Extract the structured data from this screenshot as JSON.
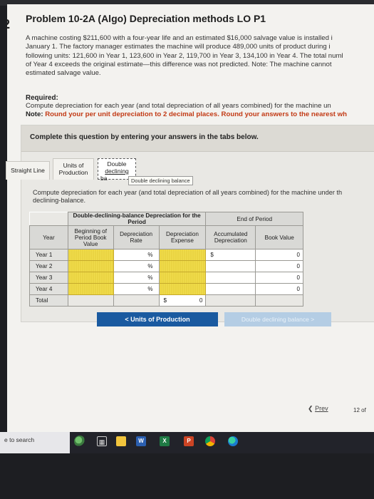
{
  "problem": {
    "marker": "2",
    "title": "Problem 10-2A (Algo) Depreciation methods LO P1",
    "paragraph": [
      "A machine costing $211,600 with a four-year life and an estimated $16,000 salvage value is installed i",
      "January 1. The factory manager estimates the machine will produce 489,000 units of product during i",
      "following units: 121,600 in Year 1, 123,600 in Year 2, 119,700 in Year 3, 134,100 in Year 4. The total numl",
      "of Year 4 exceeds the original estimate—this difference was not predicted. Note: The machine cannot",
      "estimated salvage value."
    ],
    "required_label": "Required:",
    "required_text": "Compute depreciation for each year (and total depreciation of all years combined) for the machine un",
    "note_label": "Note:",
    "note_text": "Round your per unit depreciation to 2 decimal places. Round your answers to the nearest wh"
  },
  "panel": {
    "title": "Complete this question by entering your answers in the tabs below.",
    "tabs": [
      {
        "label": "Straight Line"
      },
      {
        "label_l1": "Units of",
        "label_l2": "Production"
      },
      {
        "label_l1": "Double",
        "label_l2": "declining",
        "label_l3": "ba"
      }
    ],
    "tooltip": "Double declining balance",
    "instruction_l1": "Compute depreciation for each year (and total depreciation of all years combined) for the machine under th",
    "instruction_l2": "declining-balance."
  },
  "table": {
    "group1": "Double-declining-balance Depreciation for the Period",
    "group2": "End of Period",
    "col_year": "Year",
    "col_beginning": "Beginning of Period Book Value",
    "col_rate": "Depreciation Rate",
    "col_expense": "Depreciation Expense",
    "col_accum": "Accumulated Depreciation",
    "col_book": "Book Value",
    "rows": [
      {
        "year": "Year 1",
        "rate_unit": "%",
        "accum_unit": "$",
        "book": "0"
      },
      {
        "year": "Year 2",
        "rate_unit": "%",
        "accum_unit": "",
        "book": "0"
      },
      {
        "year": "Year 3",
        "rate_unit": "%",
        "accum_unit": "",
        "book": "0"
      },
      {
        "year": "Year 4",
        "rate_unit": "%",
        "accum_unit": "",
        "book": "0"
      }
    ],
    "total": {
      "label": "Total",
      "expense_unit": "$",
      "expense": "0"
    }
  },
  "nav": {
    "prev_tab_button": "< Units of Production",
    "next_tab_button": "Double declining balance >",
    "prev": "Prev",
    "page": "12 of"
  },
  "taskbar": {
    "search": "e to search",
    "icons": [
      "people-icon",
      "task-view-icon",
      "file-explorer-icon",
      "word-icon",
      "excel-icon",
      "powerpoint-icon",
      "chrome-icon",
      "edge-icon"
    ]
  }
}
